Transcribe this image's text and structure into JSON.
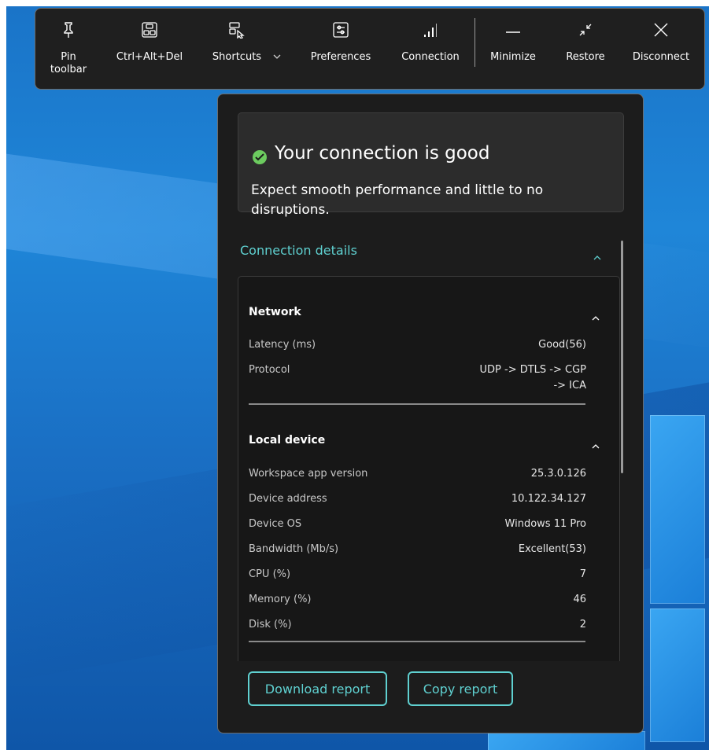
{
  "toolbar": {
    "buttons": [
      {
        "id": "pin",
        "label_line1": "Pin",
        "label_line2": "toolbar",
        "icon": "pin-icon"
      },
      {
        "id": "ctrl_alt_del",
        "label": "Ctrl+Alt+Del",
        "icon": "keyboard-keys-icon"
      },
      {
        "id": "shortcuts",
        "label": "Shortcuts",
        "icon": "shortcuts-icon"
      },
      {
        "id": "preferences",
        "label": "Preferences",
        "icon": "preferences-icon"
      },
      {
        "id": "connection",
        "label": "Connection",
        "icon": "signal-bars-icon"
      },
      {
        "id": "minimize",
        "label": "Minimize",
        "icon": "minimize-icon"
      },
      {
        "id": "restore",
        "label": "Restore",
        "icon": "restore-icon"
      },
      {
        "id": "disconnect",
        "label": "Disconnect",
        "icon": "close-icon"
      }
    ]
  },
  "panel": {
    "status": {
      "title": "Your connection is good",
      "description": "Expect smooth performance and little to no disruptions.",
      "color": "#6ccb5f"
    },
    "details_title": "Connection details",
    "accent_color": "#5fd0d0",
    "network": {
      "title": "Network",
      "rows": [
        {
          "label": "Latency (ms)",
          "value": "Good(56)"
        },
        {
          "label": "Protocol",
          "value_line1": "UDP -> DTLS -> CGP",
          "value_line2": "-> ICA"
        }
      ]
    },
    "local_device": {
      "title": "Local device",
      "rows": [
        {
          "label": "Workspace app version",
          "value": "25.3.0.126"
        },
        {
          "label": "Device address",
          "value": "10.122.34.127"
        },
        {
          "label": "Device OS",
          "value": "Windows 11 Pro"
        },
        {
          "label": "Bandwidth (Mb/s)",
          "value": "Excellent(53)"
        },
        {
          "label": "CPU (%)",
          "value": "7"
        },
        {
          "label": "Memory (%)",
          "value": "46"
        },
        {
          "label": "Disk (%)",
          "value": "2"
        }
      ]
    },
    "download_label": "Download report",
    "copy_label": "Copy report"
  }
}
